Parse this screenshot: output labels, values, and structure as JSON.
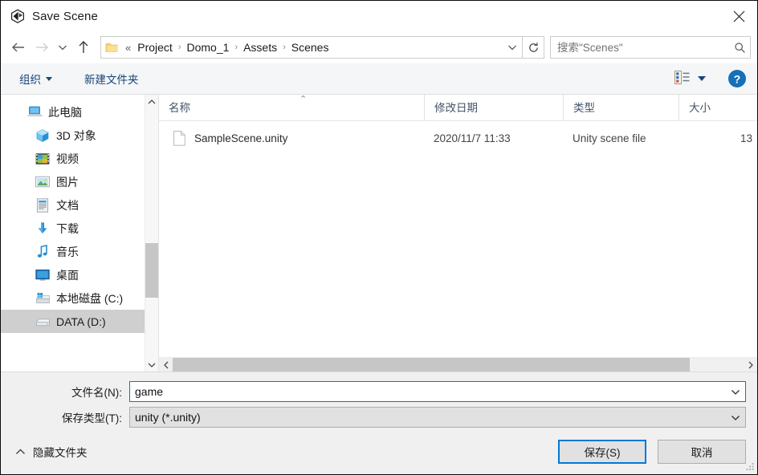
{
  "window": {
    "title": "Save Scene",
    "logo_icon": "unity-logo-icon",
    "close_icon": "close-icon"
  },
  "nav": {
    "back_icon": "back-arrow-icon",
    "forward_icon": "forward-arrow-icon",
    "recent_icon": "chevron-down-icon",
    "up_icon": "up-arrow-icon",
    "folder_icon": "folder-icon",
    "breadcrumb_prefix": "«",
    "breadcrumbs": [
      "Project",
      "Domo_1",
      "Assets",
      "Scenes"
    ],
    "separator": "›",
    "address_dropdown_icon": "chevron-down-icon",
    "refresh_icon": "refresh-icon"
  },
  "search": {
    "placeholder": "搜索\"Scenes\"",
    "value": "",
    "icon": "search-icon"
  },
  "toolbar": {
    "organize_label": "组织",
    "new_folder_label": "新建文件夹",
    "view_icon": "list-view-icon",
    "view_dropdown_icon": "caret-down-icon",
    "help_icon": "help-icon",
    "help_label": "?"
  },
  "sidebar": {
    "items": [
      {
        "label": "此电脑",
        "icon": "this-pc-icon",
        "indent": 1,
        "selected": false
      },
      {
        "label": "3D 对象",
        "icon": "3d-objects-icon",
        "indent": 2,
        "selected": false
      },
      {
        "label": "视频",
        "icon": "videos-icon",
        "indent": 2,
        "selected": false
      },
      {
        "label": "图片",
        "icon": "pictures-icon",
        "indent": 2,
        "selected": false
      },
      {
        "label": "文档",
        "icon": "documents-icon",
        "indent": 2,
        "selected": false
      },
      {
        "label": "下载",
        "icon": "downloads-icon",
        "indent": 2,
        "selected": false
      },
      {
        "label": "音乐",
        "icon": "music-icon",
        "indent": 2,
        "selected": false
      },
      {
        "label": "桌面",
        "icon": "desktop-icon",
        "indent": 2,
        "selected": false
      },
      {
        "label": "本地磁盘 (C:)",
        "icon": "local-disk-icon",
        "indent": 2,
        "selected": false
      },
      {
        "label": "DATA (D:)",
        "icon": "drive-icon",
        "indent": 2,
        "selected": true
      }
    ],
    "scroll_up_icon": "chevron-up-icon",
    "scroll_down_icon": "chevron-down-icon"
  },
  "filelist": {
    "columns": [
      {
        "label": "名称",
        "sorted": "asc"
      },
      {
        "label": "修改日期",
        "sorted": ""
      },
      {
        "label": "类型",
        "sorted": ""
      },
      {
        "label": "大小",
        "sorted": ""
      }
    ],
    "sort_caret": "⌃",
    "rows": [
      {
        "name": "SampleScene.unity",
        "icon": "file-icon",
        "date": "2020/11/7 11:33",
        "type": "Unity scene file",
        "size": "13"
      }
    ],
    "hscroll_left_icon": "chevron-left-icon",
    "hscroll_right_icon": "chevron-right-icon"
  },
  "form": {
    "filename_label": "文件名(N):",
    "filename_value": "game",
    "filename_placeholder": "",
    "filename_dropdown_icon": "chevron-down-icon",
    "savetype_label": "保存类型(T):",
    "savetype_value": "unity (*.unity)",
    "savetype_dropdown_icon": "chevron-down-icon"
  },
  "actions": {
    "hide_folders_label": "隐藏文件夹",
    "hide_folders_icon": "chevron-up-icon",
    "save_label": "保存(S)",
    "cancel_label": "取消",
    "resize_grip_icon": "resize-grip-icon"
  },
  "colors": {
    "accent": "#0078d7",
    "command_text": "#17457a",
    "header_text": "#44546a",
    "selection": "#cfcfcf"
  }
}
